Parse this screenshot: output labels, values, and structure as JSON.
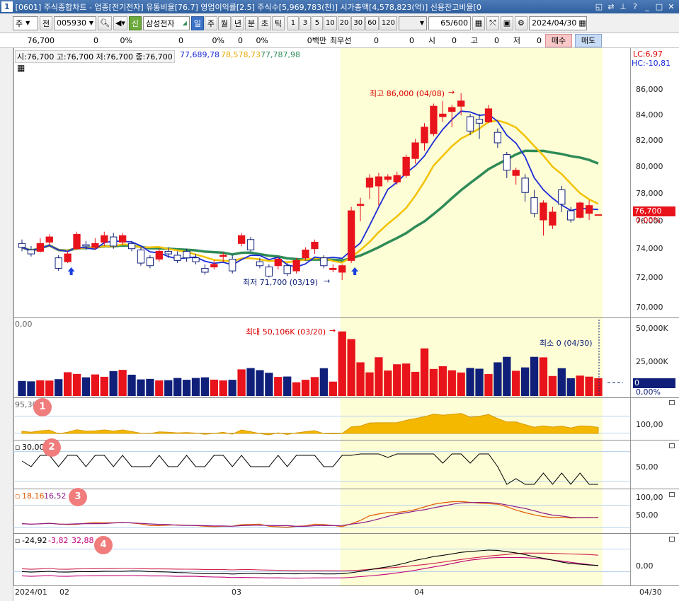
{
  "window": {
    "number": "1",
    "title": "[0601] 주식종합차트 - 업종[전기전자] 유통비율[76.7] 영업이익률[2.5] 주식수[5,969,783(천)] 시가총액[4,578,823(억)] 신용잔고비율[0"
  },
  "toolbar": {
    "market_select": "주",
    "prev_label": "전",
    "code": "005930",
    "badge_shin": "신",
    "stock_name": "삼성전자",
    "period_tabs": [
      "일",
      "주",
      "월",
      "년",
      "분",
      "초",
      "틱"
    ],
    "active_period": "일",
    "intervals": [
      "1",
      "3",
      "5",
      "10",
      "20",
      "30",
      "60",
      "120"
    ],
    "count": "65",
    "count_total": "/600",
    "date": "2024/04/30"
  },
  "quote": {
    "price": "76,700",
    "change": "0",
    "change_rate": "0%",
    "volume": "0",
    "vol_rate": "0%",
    "v3": "0",
    "v3_rate": "0%",
    "amount": "0백만",
    "best_label": "최우선",
    "best_v1": "0",
    "best_v2": "0",
    "ohlc_labels": [
      "시",
      "고",
      "저"
    ],
    "ohlc_values": [
      "0",
      "0",
      "0"
    ],
    "buy": "매수",
    "sell": "매도"
  },
  "price_panel": {
    "info": "시:76,700 고:76,700 저:76,700 종:76,700",
    "ma1": "77,689,78",
    "ma2": "78,578,73",
    "ma3": "77,787,98",
    "lc": "LC:6,97",
    "hc": "HC:-10,81",
    "high_annot": "최고 86,000 (04/08)",
    "low_annot": "최저 71,700 (03/19)",
    "current_price": "76,700",
    "current_pct": "0,00%",
    "y_ticks": [
      "86,000",
      "84,000",
      "82,000",
      "80,000",
      "78,000",
      "76,000",
      "74,000",
      "72,000",
      "70,000"
    ]
  },
  "volume_panel": {
    "label": "0,00",
    "max_annot": "최대 50,106K (03/20)",
    "min_annot": "최소 0 (04/30)",
    "y_ticks": [
      "50,000K",
      "25,000K"
    ],
    "current": "0",
    "current_pct": "0,00%"
  },
  "indicators": [
    {
      "badge": "1",
      "value": "95,30",
      "tick": "100,00"
    },
    {
      "badge": "2",
      "value": "30,00",
      "tick": "50,00"
    },
    {
      "badge": "3",
      "v1": "18,16",
      "v2": "16,52",
      "ticks": [
        "100,00",
        "50,00"
      ]
    },
    {
      "badge": "4",
      "v1": "-24,92",
      "v2": "-3,82",
      "v3": "32,88",
      "tick": "0,00"
    }
  ],
  "x_axis": {
    "labels": [
      "2024/01",
      "02",
      "03",
      "04"
    ],
    "right_label": "04/30"
  },
  "colors": {
    "up": "#e8131b",
    "down": "#10207a",
    "ma_short": "#1a2ad6",
    "ma_mid": "#f2c200",
    "ma_long": "#2e8b57",
    "highlight": "#fdfdd6"
  },
  "chart_data": {
    "type": "candlestick",
    "y_range": [
      69000,
      87500
    ],
    "candles": [
      {
        "o": 74500,
        "c": 74200,
        "h": 74800,
        "l": 73900
      },
      {
        "o": 74000,
        "c": 73700,
        "h": 74300,
        "l": 73500
      },
      {
        "o": 73900,
        "c": 74500,
        "h": 74900,
        "l": 73800
      },
      {
        "o": 74600,
        "c": 75000,
        "h": 75200,
        "l": 74400
      },
      {
        "o": 73400,
        "c": 72600,
        "h": 73600,
        "l": 72400
      },
      {
        "o": 73100,
        "c": 73700,
        "h": 73900,
        "l": 73000
      },
      {
        "o": 74100,
        "c": 75200,
        "h": 75400,
        "l": 74000
      },
      {
        "o": 74400,
        "c": 74300,
        "h": 74700,
        "l": 74000
      },
      {
        "o": 74200,
        "c": 74500,
        "h": 74900,
        "l": 74000
      },
      {
        "o": 74600,
        "c": 75100,
        "h": 75400,
        "l": 74300
      },
      {
        "o": 75000,
        "c": 74300,
        "h": 75300,
        "l": 74100
      },
      {
        "o": 74600,
        "c": 75100,
        "h": 75300,
        "l": 74400
      },
      {
        "o": 74500,
        "c": 74100,
        "h": 74700,
        "l": 73900
      },
      {
        "o": 74000,
        "c": 73000,
        "h": 74200,
        "l": 72800
      },
      {
        "o": 73400,
        "c": 72800,
        "h": 73600,
        "l": 72600
      },
      {
        "o": 73300,
        "c": 73900,
        "h": 74100,
        "l": 73100
      },
      {
        "o": 73900,
        "c": 73700,
        "h": 74200,
        "l": 73400
      },
      {
        "o": 73600,
        "c": 73200,
        "h": 73900,
        "l": 73000
      },
      {
        "o": 73900,
        "c": 73400,
        "h": 74100,
        "l": 73100
      },
      {
        "o": 73400,
        "c": 73100,
        "h": 73700,
        "l": 72900
      },
      {
        "o": 72600,
        "c": 72300,
        "h": 72900,
        "l": 72100
      },
      {
        "o": 72700,
        "c": 72900,
        "h": 73200,
        "l": 72500
      },
      {
        "o": 73500,
        "c": 73600,
        "h": 73800,
        "l": 73100
      },
      {
        "o": 73300,
        "c": 72400,
        "h": 73600,
        "l": 72200
      },
      {
        "o": 74500,
        "c": 75100,
        "h": 75300,
        "l": 74300
      },
      {
        "o": 74800,
        "c": 74000,
        "h": 75000,
        "l": 73900
      },
      {
        "o": 73100,
        "c": 72800,
        "h": 73400,
        "l": 72600
      },
      {
        "o": 72700,
        "c": 72000,
        "h": 72900,
        "l": 71900
      },
      {
        "o": 72800,
        "c": 73300,
        "h": 73500,
        "l": 72500
      },
      {
        "o": 72800,
        "c": 72200,
        "h": 73000,
        "l": 72000
      },
      {
        "o": 72400,
        "c": 73200,
        "h": 73400,
        "l": 72200
      },
      {
        "o": 73400,
        "c": 74000,
        "h": 74200,
        "l": 73200
      },
      {
        "o": 74100,
        "c": 74600,
        "h": 74800,
        "l": 73700
      },
      {
        "o": 73400,
        "c": 72800,
        "h": 73600,
        "l": 72600
      },
      {
        "o": 72500,
        "c": 72600,
        "h": 72900,
        "l": 72300
      },
      {
        "o": 72300,
        "c": 72800,
        "h": 72900,
        "l": 71700
      },
      {
        "o": 73200,
        "c": 77000,
        "h": 77300,
        "l": 73000
      },
      {
        "o": 77400,
        "c": 77500,
        "h": 78000,
        "l": 76200
      },
      {
        "o": 78800,
        "c": 79500,
        "h": 79800,
        "l": 77900
      },
      {
        "o": 78900,
        "c": 79600,
        "h": 79900,
        "l": 77400
      },
      {
        "o": 79400,
        "c": 79600,
        "h": 79800,
        "l": 79200
      },
      {
        "o": 79200,
        "c": 79700,
        "h": 80000,
        "l": 79000
      },
      {
        "o": 79700,
        "c": 81100,
        "h": 81300,
        "l": 79500
      },
      {
        "o": 81000,
        "c": 82200,
        "h": 82500,
        "l": 80600
      },
      {
        "o": 82200,
        "c": 83400,
        "h": 83700,
        "l": 81600
      },
      {
        "o": 82900,
        "c": 85000,
        "h": 85200,
        "l": 82700
      },
      {
        "o": 84200,
        "c": 84400,
        "h": 85400,
        "l": 83800
      },
      {
        "o": 84600,
        "c": 84900,
        "h": 85100,
        "l": 83400
      },
      {
        "o": 85000,
        "c": 85400,
        "h": 86000,
        "l": 84300
      },
      {
        "o": 84200,
        "c": 83100,
        "h": 84400,
        "l": 82800
      },
      {
        "o": 84000,
        "c": 83700,
        "h": 84400,
        "l": 82500
      },
      {
        "o": 83800,
        "c": 84800,
        "h": 85100,
        "l": 83700
      },
      {
        "o": 83000,
        "c": 82200,
        "h": 83300,
        "l": 81800
      },
      {
        "o": 81300,
        "c": 80100,
        "h": 81500,
        "l": 79500
      },
      {
        "o": 79700,
        "c": 80100,
        "h": 80300,
        "l": 79000
      },
      {
        "o": 79500,
        "c": 78400,
        "h": 79800,
        "l": 77700
      },
      {
        "o": 78000,
        "c": 76800,
        "h": 78600,
        "l": 76500
      },
      {
        "o": 76300,
        "c": 77600,
        "h": 77800,
        "l": 75100
      },
      {
        "o": 75900,
        "c": 76900,
        "h": 77300,
        "l": 75600
      },
      {
        "o": 78600,
        "c": 77500,
        "h": 78900,
        "l": 76900
      },
      {
        "o": 77000,
        "c": 76300,
        "h": 77300,
        "l": 76100
      },
      {
        "o": 76500,
        "c": 77600,
        "h": 77700,
        "l": 76400
      },
      {
        "o": 76800,
        "c": 77400,
        "h": 77800,
        "l": 76300
      },
      {
        "o": 76700,
        "c": 76700,
        "h": 76700,
        "l": 76700
      }
    ],
    "volume_k": [
      11500,
      11200,
      12000,
      11800,
      12900,
      18200,
      16900,
      14300,
      16500,
      14700,
      19100,
      20000,
      16300,
      12700,
      13100,
      11900,
      12100,
      13800,
      12400,
      13800,
      14300,
      12500,
      11900,
      12400,
      20400,
      21400,
      19800,
      17800,
      14600,
      14900,
      10500,
      12400,
      14500,
      21300,
      11000,
      49500,
      43600,
      25800,
      18100,
      29700,
      19500,
      24300,
      24900,
      18500,
      36500,
      20700,
      22800,
      19700,
      18000,
      21500,
      20900,
      16800,
      25800,
      30000,
      19300,
      21900,
      30000,
      29600,
      15300,
      21300,
      13600,
      15600,
      14800,
      13600,
      0
    ]
  }
}
